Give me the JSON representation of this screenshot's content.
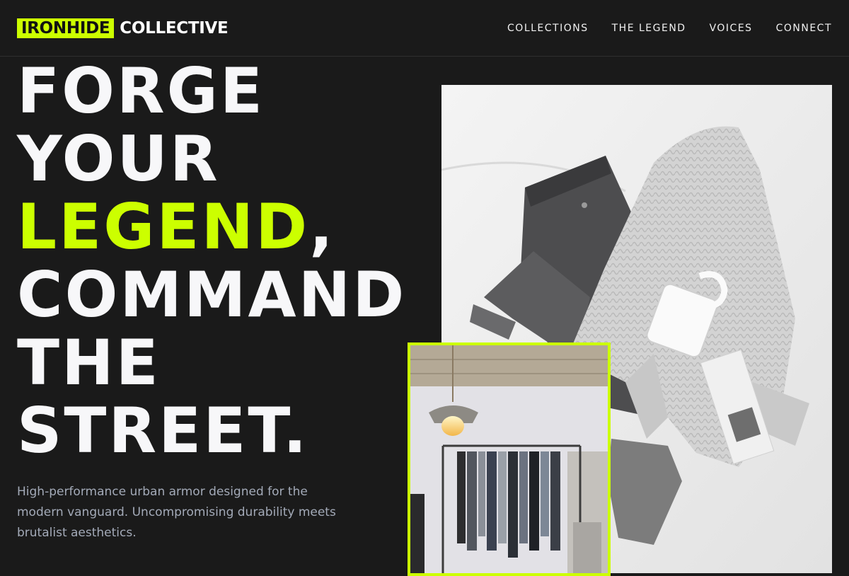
{
  "brand": {
    "mark": "IRONHIDE",
    "name": "COLLECTIVE"
  },
  "nav": {
    "links": [
      "COLLECTIONS",
      "THE LEGEND",
      "VOICES",
      "CONNECT"
    ]
  },
  "hero": {
    "line1": "FORGE",
    "line2": "YOUR",
    "line3_accent": "LEGEND",
    "line3_rest": ",",
    "line4": "COMMAND",
    "line5": "THE",
    "line6": "STREET.",
    "tagline": "High-performance urban armor designed for the modern vanguard. Uncompromising durability meets brutalist aesthetics."
  },
  "images": {
    "main_icon": "flatlay-photo",
    "inset_icon": "store-interior-photo"
  },
  "colors": {
    "background": "#1a1a1a",
    "accent": "#ccff00",
    "text": "#f4f4f6",
    "muted": "#a3aab8"
  }
}
